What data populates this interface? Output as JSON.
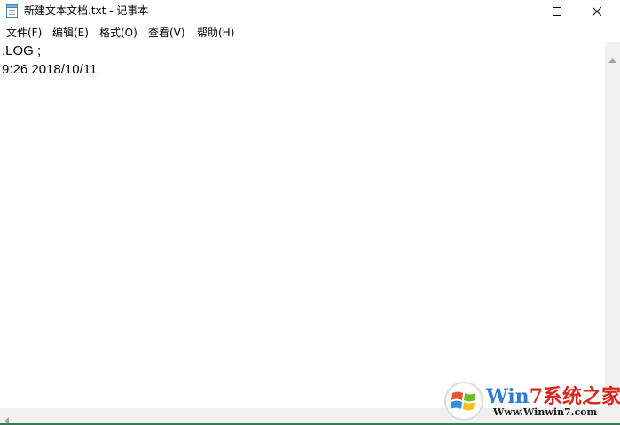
{
  "window": {
    "title": "新建文本文档.txt - 记事本"
  },
  "caption_buttons": {
    "minimize": "minimize-icon",
    "maximize": "maximize-icon",
    "close": "close-icon"
  },
  "menu": {
    "items": [
      {
        "label": "文件(F)"
      },
      {
        "label": "编辑(E)"
      },
      {
        "label": "格式(O)"
      },
      {
        "label": "查看(V)"
      },
      {
        "label": "帮助(H)"
      }
    ]
  },
  "editor": {
    "lines": [
      ".LOG ;",
      "9:26 2018/10/11"
    ]
  },
  "watermark": {
    "brand_prefix": "Win",
    "brand_rest": "7系统之家",
    "url": "Www.Winwin7.com"
  },
  "colors": {
    "brand_blue": "#2f7fd0",
    "brand_red": "#d9261c"
  }
}
